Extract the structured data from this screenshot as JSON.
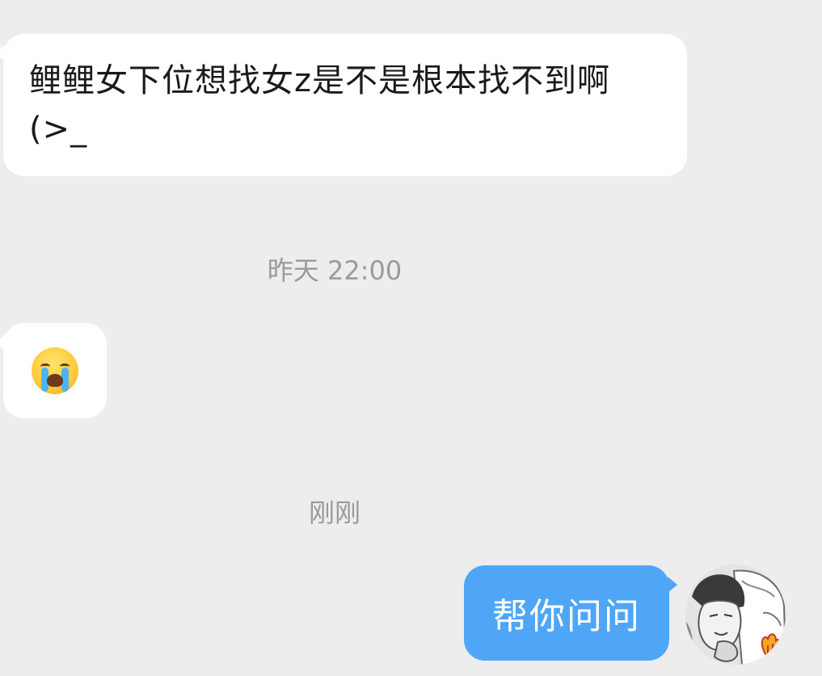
{
  "messages": [
    {
      "side": "left",
      "type": "text",
      "text": "鲤鲤女下位想找女z是不是根本找不到啊 (>_"
    },
    {
      "side": "left",
      "type": "emoji",
      "emoji": "loudly-crying-face"
    }
  ],
  "timestamps": {
    "yesterday": "昨天 22:00",
    "just_now": "刚刚"
  },
  "outgoing": {
    "text": "帮你问问"
  },
  "colors": {
    "background": "#EDEDED",
    "incoming_bubble": "#FFFFFF",
    "outgoing_bubble": "#4FA6F6",
    "timestamp_text": "#9A9A9A"
  }
}
